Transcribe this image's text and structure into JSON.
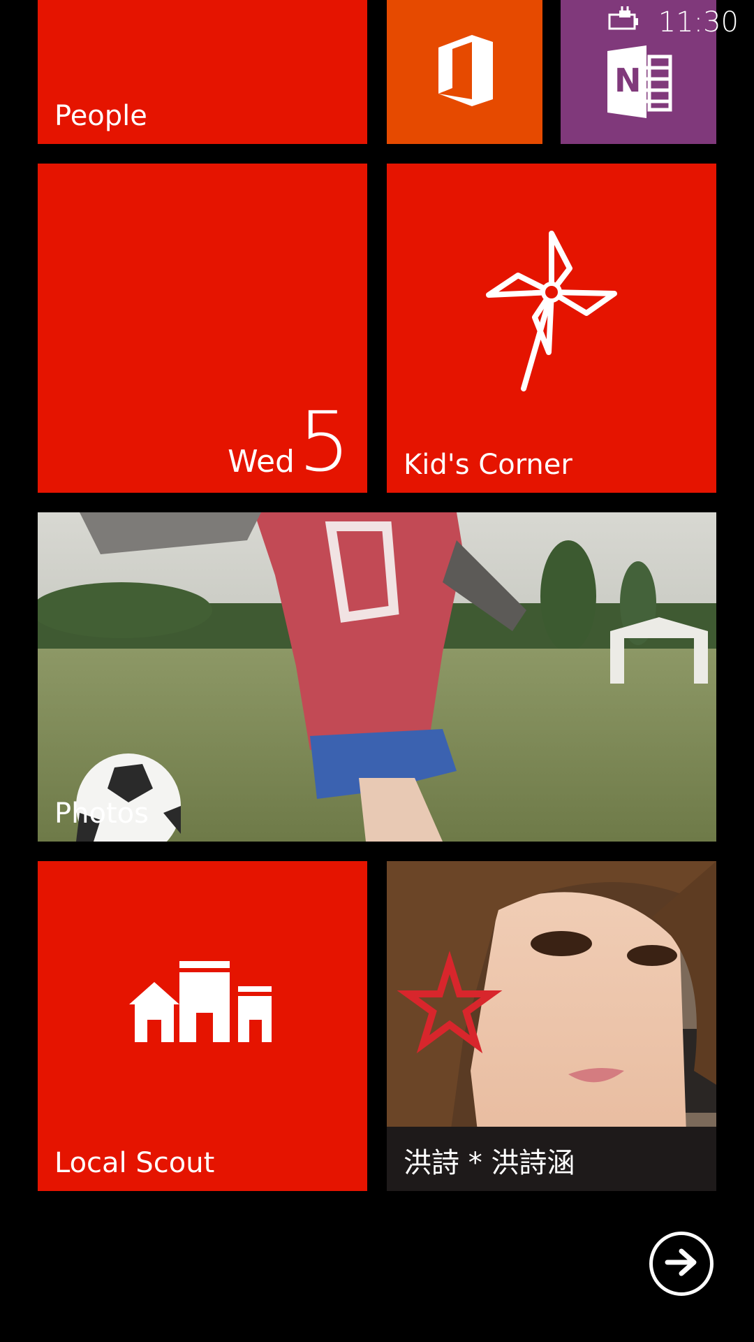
{
  "status_bar": {
    "time": "11:30",
    "icons": [
      "battery-charging-icon"
    ]
  },
  "accent_color": "#E51400",
  "tiles": {
    "people": {
      "label": "People",
      "color": "#E51400"
    },
    "office": {
      "label": "",
      "icon": "office-icon",
      "color": "#E64A00"
    },
    "onenote": {
      "label": "",
      "icon": "onenote-icon",
      "color": "#80397B"
    },
    "calendar": {
      "weekday": "Wed",
      "day": "5",
      "color": "#E51400"
    },
    "kids_corner": {
      "label": "Kid's Corner",
      "icon": "pinwheel-icon",
      "color": "#E51400"
    },
    "photos": {
      "label": "Photos"
    },
    "local_scout": {
      "label": "Local Scout",
      "icon": "buildings-icon",
      "color": "#E51400"
    },
    "contact": {
      "label": "洪詩 * 洪詩涵"
    }
  },
  "navigation": {
    "app_list_icon": "arrow-right-circle-icon"
  }
}
